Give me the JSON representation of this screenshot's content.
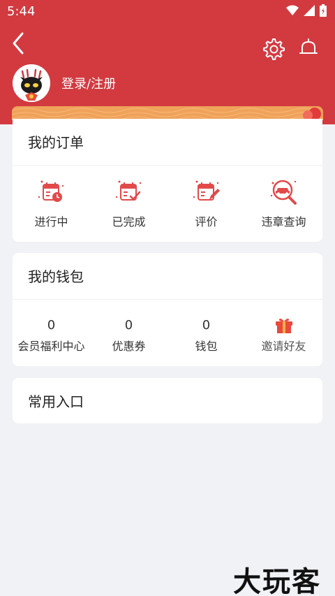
{
  "status_bar": {
    "time": "5:44"
  },
  "header": {
    "login_label": "登录/注册"
  },
  "orders": {
    "title": "我的订单",
    "items": [
      {
        "label": "进行中",
        "icon": "calendar-clock-icon"
      },
      {
        "label": "已完成",
        "icon": "calendar-check-icon"
      },
      {
        "label": "评价",
        "icon": "calendar-edit-icon"
      },
      {
        "label": "违章查询",
        "icon": "car-search-icon"
      }
    ]
  },
  "wallet": {
    "title": "我的钱包",
    "items": [
      {
        "value": "0",
        "label": "会员福利中心"
      },
      {
        "value": "0",
        "label": "优惠券"
      },
      {
        "value": "0",
        "label": "钱包"
      },
      {
        "label": "邀请好友",
        "icon": "gift-icon"
      }
    ]
  },
  "common": {
    "title": "常用入口"
  },
  "watermark": "大玩客",
  "colors": {
    "brand_red": "#d23a3f",
    "banner_orange": "#f0a25a",
    "page_bg": "#f1f2f6"
  }
}
